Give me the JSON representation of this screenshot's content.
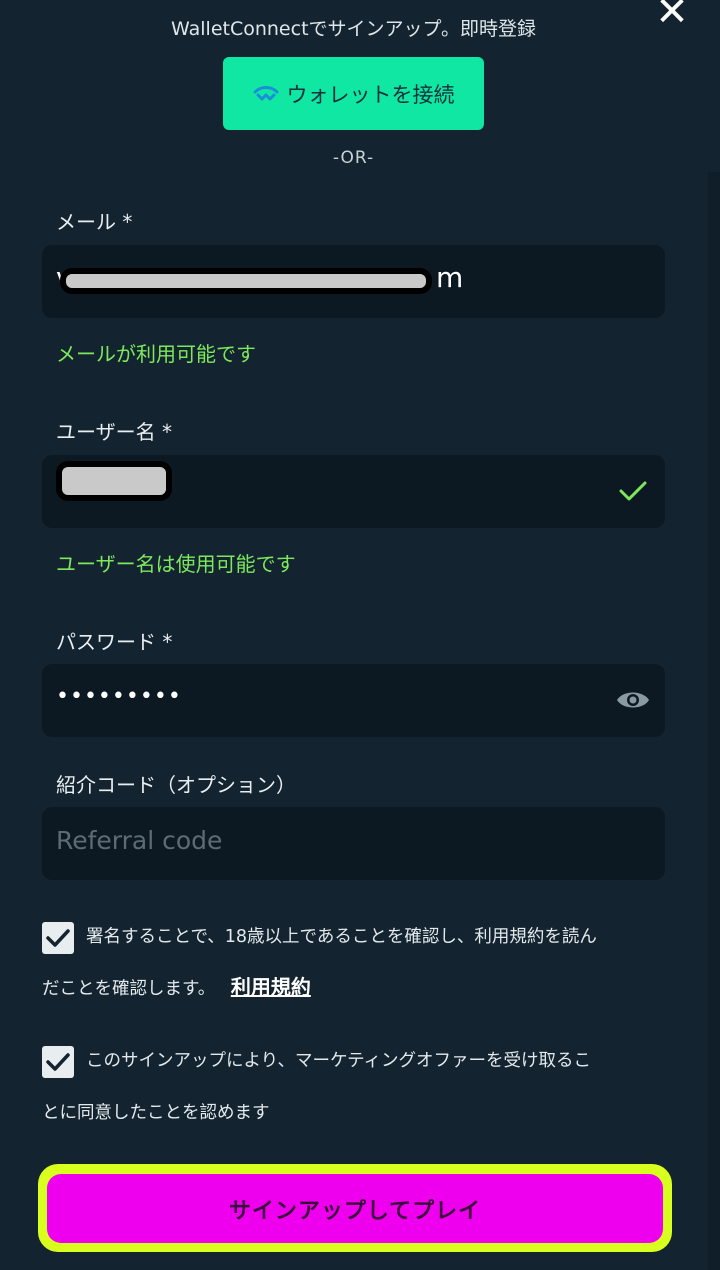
{
  "header": {
    "close_symbol": "✕",
    "wallet_connect_text": "WalletConnectでサインアップ。即時登録",
    "wallet_button_label": "ウォレットを接続",
    "or_text": "-OR-"
  },
  "email": {
    "label": "メール *",
    "value_tail": "m",
    "status": "メールが利用可能です"
  },
  "username": {
    "label": "ユーザー名 *",
    "status": "ユーザー名は使用可能です"
  },
  "password": {
    "label": "パスワード *",
    "masked_value": "•••••••••"
  },
  "referral": {
    "label": "紹介コード（オプション）",
    "placeholder": "Referral code"
  },
  "consents": {
    "age_text_line1": "署名することで、18歳以上であることを確認し、利用規約を読ん",
    "age_text_line2": "だことを確認します。",
    "terms_link": "利用規約",
    "marketing_text_line1": "このサインアップにより、マーケティングオファーを受け取るこ",
    "marketing_text_line2": "とに同意したことを認めます",
    "age_checked": true,
    "marketing_checked": true
  },
  "cta": {
    "label": "サインアップしてプレイ"
  },
  "icons": {
    "close": "close-icon",
    "walletconnect": "walletconnect-icon",
    "valid": "checkmark-icon",
    "visibility": "eye-icon",
    "checkbox": "checkbox-checked-icon"
  },
  "colors": {
    "background": "#132430",
    "field": "#0c1922",
    "wallet_button": "#0fe7a3",
    "success_text": "#7ee85c",
    "cta_fill": "#ee00ee",
    "cta_outline": "#d9ff1f"
  }
}
